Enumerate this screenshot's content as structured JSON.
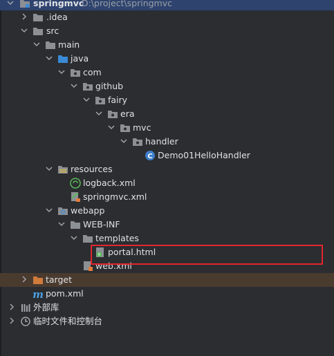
{
  "tree": {
    "root": {
      "name": "springmvc",
      "path": "D:\\project\\springmvc"
    },
    "idea": ".idea",
    "src": "src",
    "main": "main",
    "java": "java",
    "com": "com",
    "github": "github",
    "fairy": "fairy",
    "era": "era",
    "mvc": "mvc",
    "handler": "handler",
    "class_file": "Demo01HelloHandler",
    "resources": "resources",
    "logback": "logback.xml",
    "springmvc_xml": "springmvc.xml",
    "webapp": "webapp",
    "webinf": "WEB-INF",
    "templates": "templates",
    "portal": "portal.html",
    "webxml": "web.xml",
    "target": "target",
    "pom": "pom.xml",
    "ext_libs": "外部库",
    "scratches": "临时文件和控制台"
  },
  "colors": {
    "background": "#2b2d30",
    "selection": "#2e436e",
    "excluded": "#4a3b2f",
    "annotation": "#e3262e",
    "folder": "#8c8f94",
    "source_folder": "#3b8ad6"
  }
}
